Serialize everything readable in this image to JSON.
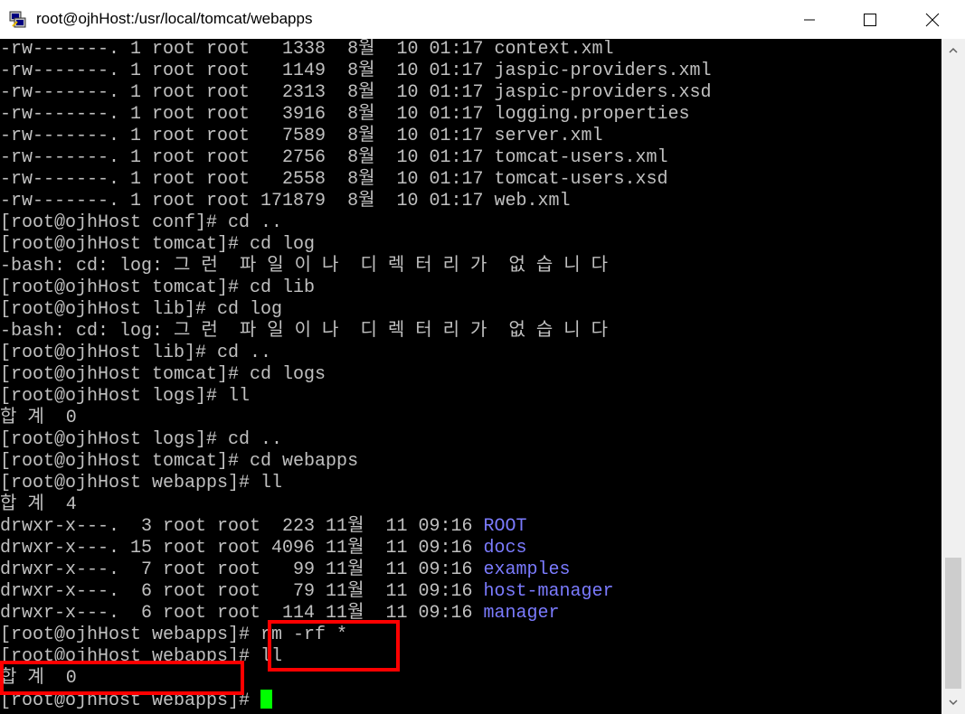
{
  "window": {
    "title": "root@ojhHost:/usr/local/tomcat/webapps",
    "app_icon": "putty-icon",
    "controls": [
      "minimize-icon",
      "maximize-icon",
      "close-icon"
    ]
  },
  "terminal": {
    "lines": [
      {
        "text": "-rw-------. 1 root root   1338  8월  10 01:17 context.xml"
      },
      {
        "text": "-rw-------. 1 root root   1149  8월  10 01:17 jaspic-providers.xml"
      },
      {
        "text": "-rw-------. 1 root root   2313  8월  10 01:17 jaspic-providers.xsd"
      },
      {
        "text": "-rw-------. 1 root root   3916  8월  10 01:17 logging.properties"
      },
      {
        "text": "-rw-------. 1 root root   7589  8월  10 01:17 server.xml"
      },
      {
        "text": "-rw-------. 1 root root   2756  8월  10 01:17 tomcat-users.xml"
      },
      {
        "text": "-rw-------. 1 root root   2558  8월  10 01:17 tomcat-users.xsd"
      },
      {
        "text": "-rw-------. 1 root root 171879  8월  10 01:17 web.xml"
      },
      {
        "text": "[root@ojhHost conf]# cd .."
      },
      {
        "text": "[root@ojhHost tomcat]# cd log"
      },
      {
        "text": "-bash: cd: log: 그 런  파 일 이 나  디 렉 터 리 가  없 습 니 다"
      },
      {
        "text": "[root@ojhHost tomcat]# cd lib"
      },
      {
        "text": "[root@ojhHost lib]# cd log"
      },
      {
        "text": "-bash: cd: log: 그 런  파 일 이 나  디 렉 터 리 가  없 습 니 다"
      },
      {
        "text": "[root@ojhHost lib]# cd .."
      },
      {
        "text": "[root@ojhHost tomcat]# cd logs"
      },
      {
        "text": "[root@ojhHost logs]# ll"
      },
      {
        "text": "합 계  0"
      },
      {
        "text": "[root@ojhHost logs]# cd .."
      },
      {
        "text": "[root@ojhHost tomcat]# cd webapps"
      },
      {
        "text": "[root@ojhHost webapps]# ll"
      },
      {
        "text": "합 계  4"
      },
      {
        "text": "drwxr-x---.  3 root root  223 11월  11 09:16 ",
        "dir": "ROOT"
      },
      {
        "text": "drwxr-x---. 15 root root 4096 11월  11 09:16 ",
        "dir": "docs"
      },
      {
        "text": "drwxr-x---.  7 root root   99 11월  11 09:16 ",
        "dir": "examples"
      },
      {
        "text": "drwxr-x---.  6 root root   79 11월  11 09:16 ",
        "dir": "host-manager"
      },
      {
        "text": "drwxr-x---.  6 root root  114 11월  11 09:16 ",
        "dir": "manager"
      },
      {
        "text": "[root@ojhHost webapps]# rm -rf *"
      },
      {
        "text": "[root@ojhHost webapps]# ll"
      },
      {
        "text": "합 계  0"
      },
      {
        "text": "[root@ojhHost webapps]# ",
        "cursor": true
      }
    ],
    "colors": {
      "background": "#000000",
      "foreground": "#c0c0c0",
      "directory": "#7b7bff",
      "cursor": "#00ff00",
      "highlight_box": "#ff0000"
    }
  }
}
